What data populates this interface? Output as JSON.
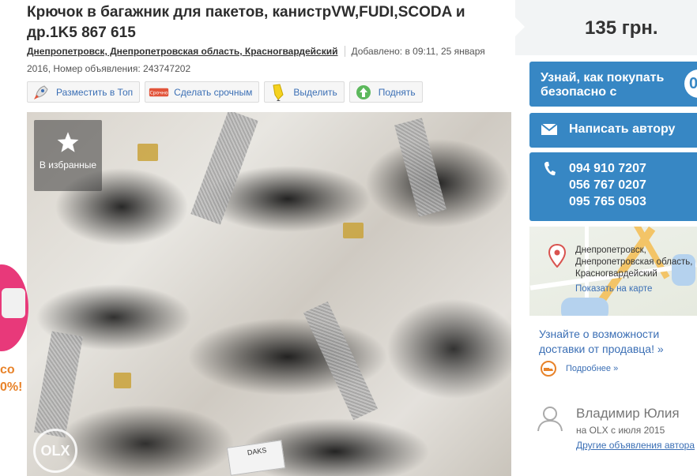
{
  "ad": {
    "title": "Крючок в багажник для пакетов, канистрVW,FUDI,SCODA и др.1K5 867 615",
    "location": "Днепропетровск, Днепропетровская область, Красногвардейский",
    "added": "Добавлено: в 09:11, 25 января 2016, Номер объявления: 243747202"
  },
  "actions": [
    {
      "label": "Разместить в Топ",
      "icon": "rocket-icon"
    },
    {
      "label": "Сделать срочным",
      "icon": "urgent-tag-icon",
      "badge": "Срочно"
    },
    {
      "label": "Выделить",
      "icon": "highlighter-icon"
    },
    {
      "label": "Поднять",
      "icon": "up-arrow-icon"
    }
  ],
  "photo": {
    "favorite_label": "В избранные",
    "watermark": "OLX",
    "sticker_text": "DAKS"
  },
  "promo": {
    "text_lines": [
      "со",
      "0%!"
    ]
  },
  "sidebar": {
    "price": "135 грн.",
    "safe_buy_label": "Узнай, как покупать безопасно с",
    "safe_buy_badge": "0",
    "write_author_label": "Написать автору",
    "phones": [
      "094 910 7207",
      "056 767 0207",
      "095 765 0503"
    ],
    "map_address": "Днепропетровск, Днепропетровская область, Красногвардейский",
    "map_link": "Показать на карте",
    "learn_more": "Узнайте о возможности доставки от продавца! »",
    "more_link": "Подробнее »",
    "seller_name": "Владимир Юлия",
    "seller_since": "на OLX с июля 2015",
    "other_ads": "Другие объявления автора"
  },
  "colors": {
    "accent_blue": "#3787c4",
    "link_blue": "#3b6fb5",
    "promo_pink": "#e8397a"
  }
}
